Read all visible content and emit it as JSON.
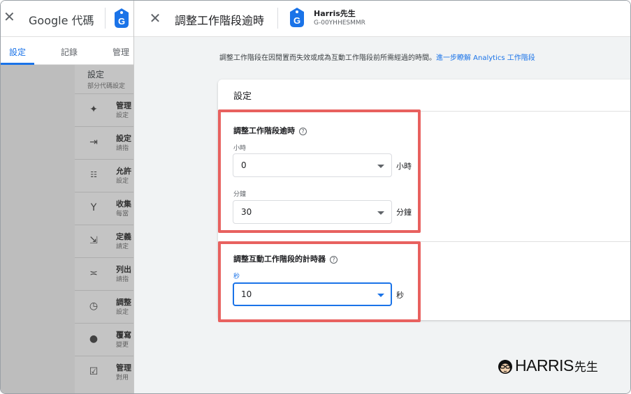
{
  "background": {
    "title": "Google 代碼",
    "tabs": [
      {
        "label": "設定",
        "active": true
      },
      {
        "label": "記錄",
        "active": false
      },
      {
        "label": "管理",
        "active": false
      }
    ],
    "panel_heading": "設定",
    "panel_subheading": "部分代碼設定",
    "rows": [
      {
        "icon": "sparkle-icon",
        "title": "管理",
        "subtitle": "設定"
      },
      {
        "icon": "merge-arrows-icon",
        "title": "設定",
        "subtitle": "請指"
      },
      {
        "icon": "domain-list-icon",
        "title": "允許",
        "subtitle": "設定"
      },
      {
        "icon": "fork-icon",
        "title": "收集",
        "subtitle": "每當"
      },
      {
        "icon": "login-icon",
        "title": "定義",
        "subtitle": "請定"
      },
      {
        "icon": "list-exclude-icon",
        "title": "列出",
        "subtitle": "請指"
      },
      {
        "icon": "clock-icon",
        "title": "調整",
        "subtitle": "設定"
      },
      {
        "icon": "cookie-icon",
        "title": "覆寫",
        "subtitle": "變更"
      },
      {
        "icon": "form-icon",
        "title": "管理",
        "subtitle": "對用"
      }
    ]
  },
  "overlay": {
    "title": "調整工作階段逾時",
    "account_name": "Harris先生",
    "account_id": "G-00YHHESMMR",
    "description": "調整工作階段在因閒置而失效或成為互動工作階段前所需經過的時間。",
    "learn_more": "進一步瞭解 Analytics 工作階段",
    "card_title": "設定",
    "session_timeout": {
      "heading": "調整工作階段逾時",
      "hours_label": "小時",
      "hours_value": "0",
      "hours_unit": "小時",
      "minutes_label": "分鐘",
      "minutes_value": "30",
      "minutes_unit": "分鐘"
    },
    "engaged_timer": {
      "heading": "調整互動工作階段的計時器",
      "seconds_label": "秒",
      "seconds_value": "10",
      "seconds_unit": "秒"
    }
  },
  "watermark": {
    "latin": "HARRIS",
    "cjk": "先生"
  },
  "colors": {
    "accent": "#1a73e8",
    "highlight": "#e8615f",
    "overlay_bg": "#f1f3f4"
  }
}
